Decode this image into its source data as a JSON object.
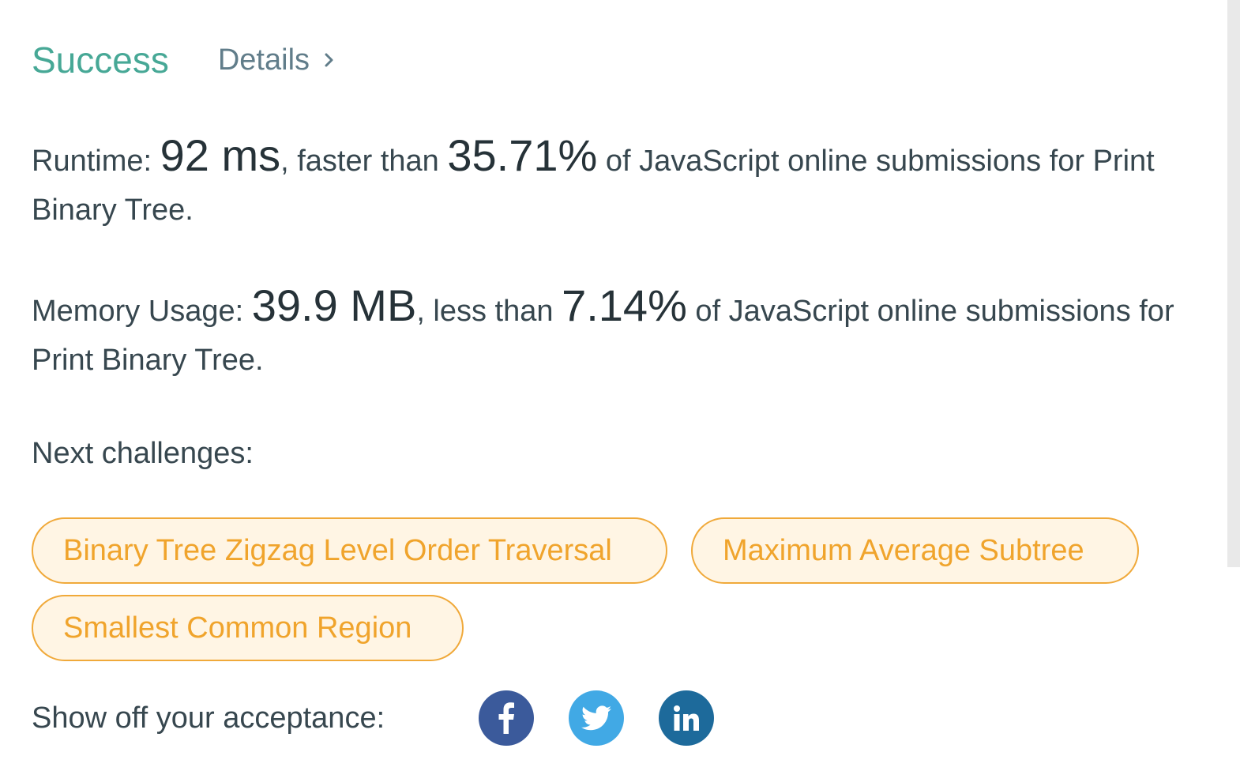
{
  "header": {
    "status": "Success",
    "details_label": "Details"
  },
  "runtime": {
    "label": "Runtime: ",
    "value": "92 ms",
    "comparison": ", faster than ",
    "percent": "35.71%",
    "suffix": " of JavaScript online submissions for Print Binary Tree."
  },
  "memory": {
    "label": "Memory Usage: ",
    "value": "39.9 MB",
    "comparison": ", less than ",
    "percent": "7.14%",
    "suffix": " of JavaScript online submissions for Print Binary Tree."
  },
  "next_challenges": {
    "label": "Next challenges:",
    "items": [
      "Binary Tree Zigzag Level Order Traversal",
      "Maximum Average Subtree",
      "Smallest Common Region"
    ]
  },
  "share": {
    "label": "Show off your acceptance:",
    "icons": [
      "facebook-icon",
      "twitter-icon",
      "linkedin-icon"
    ]
  },
  "colors": {
    "success": "#47a896",
    "pill_border": "#f0a93a",
    "pill_bg": "#fff5e4",
    "facebook": "#3b5a9b",
    "twitter": "#41a9e5",
    "linkedin": "#1d6a9b"
  }
}
